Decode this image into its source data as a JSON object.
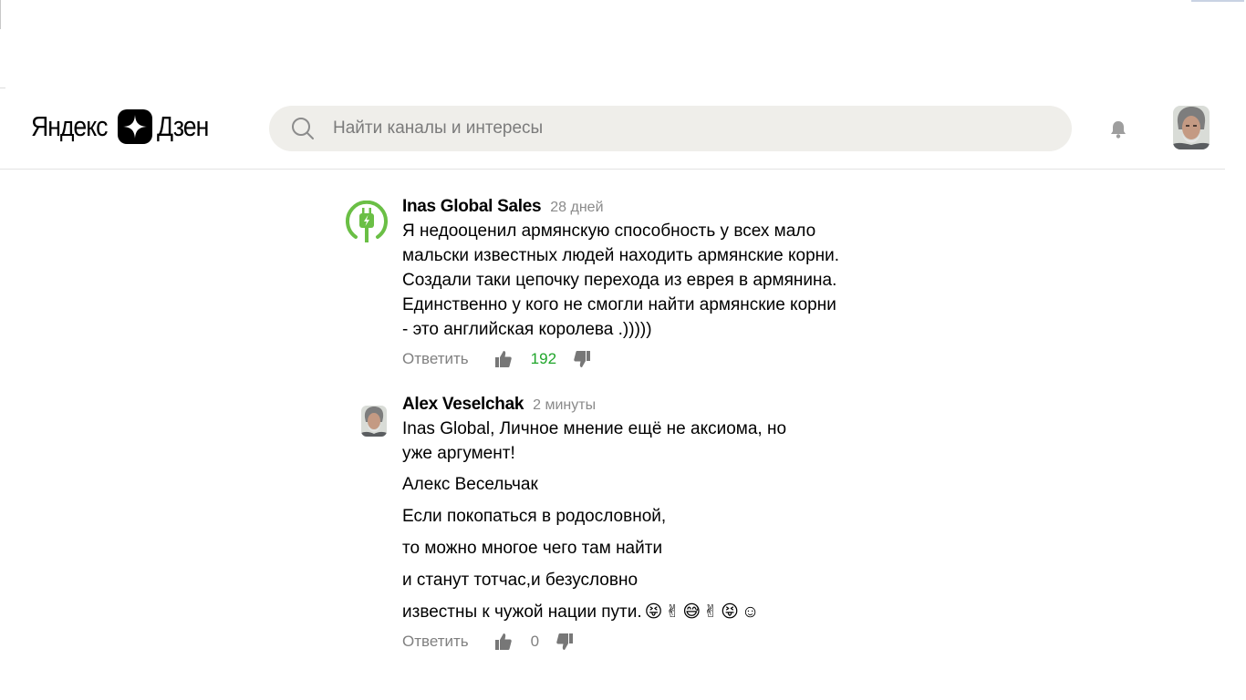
{
  "header": {
    "logo_left": "Яндекс",
    "logo_right": "Дзен",
    "search_placeholder": "Найти каналы и интересы"
  },
  "comments": [
    {
      "author": "Inas Global Sales",
      "time": "28 дней",
      "lines": [
        "Я недооценил армянскую способность у всех мало",
        "мальски известных людей находить армянские корни.",
        "Создали таки цепочку перехода из еврея в армянина.",
        "Единственно у кого не смогли найти армянские корни",
        "- это английская королева .)))))"
      ],
      "reply_label": "Ответить",
      "likes": "192"
    },
    {
      "author": "Alex Veselchak",
      "time": "2 минуты",
      "lines": [
        "Inas Global, Личное мнение ещё не аксиома, но",
        "уже аргумент!"
      ],
      "poem": [
        "Алекс Весельчак",
        "Если покопаться в родословной,",
        "то можно многое чего там найти",
        "и станут тотчас,и безусловно",
        "известны к чужой нации пути."
      ],
      "emojis": [
        "😝",
        "✌",
        "😅",
        "✌",
        "😝",
        "☺"
      ],
      "reply_label": "Ответить",
      "likes": "0"
    }
  ],
  "colors": {
    "like_positive": "#1fa52a",
    "muted": "#808080",
    "search_bg": "#efeeea",
    "plug_green": "#6abf45"
  }
}
